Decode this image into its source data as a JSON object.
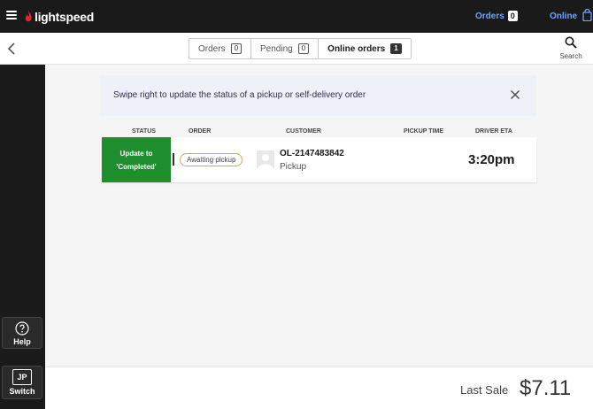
{
  "topbar": {
    "brand": "lightspeed",
    "orders_label": "Orders",
    "orders_count": "0",
    "online_label": "Online"
  },
  "tabs": [
    {
      "label": "Orders",
      "count": "0",
      "active": false
    },
    {
      "label": "Pending",
      "count": "0",
      "active": false
    },
    {
      "label": "Online orders",
      "count": "1",
      "active": true
    }
  ],
  "search": {
    "label": "Search"
  },
  "sidebar": {
    "help_label": "Help",
    "switch_initials": "JP",
    "switch_label": "Switch"
  },
  "banner": {
    "text": "Swipe right to update the status of a pickup or self-delivery order"
  },
  "table": {
    "headers": {
      "status": "STATUS",
      "order": "ORDER",
      "customer": "CUSTOMER",
      "pickup_time": "PICKUP TIME",
      "driver_eta": "DRIVER ETA"
    },
    "rows": [
      {
        "action_line1": "Update to",
        "action_line2": "'Completed'",
        "status": "Awaiting pickup",
        "order_id": "OL-2147483842",
        "order_type": "Pickup",
        "pickup_time": "",
        "driver_eta": "3:20pm"
      }
    ]
  },
  "footer": {
    "last_sale_label": "Last Sale",
    "last_sale_value": "$7.11"
  },
  "colors": {
    "topbar_bg": "#1a1a1a",
    "accent_blue": "#6ea4ff",
    "brand_red": "#e8242c",
    "action_green": "#1e8e2e",
    "pill_border": "#e0a347"
  }
}
